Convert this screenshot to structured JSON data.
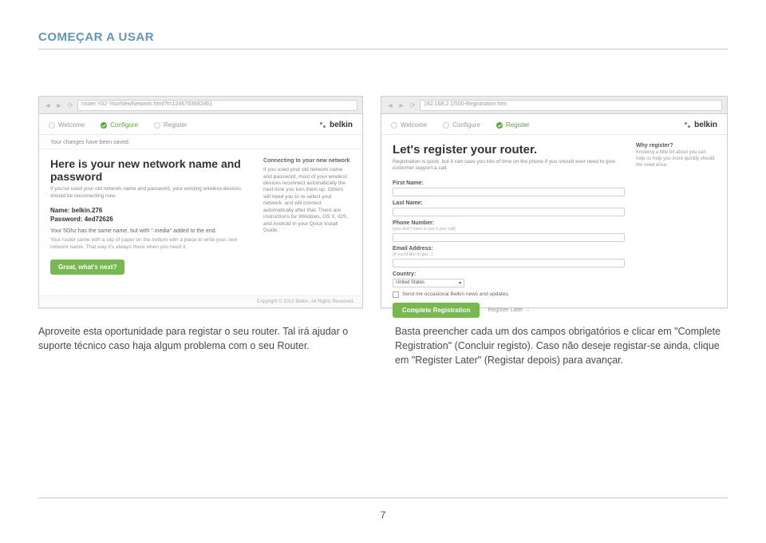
{
  "section_title": "COMEÇAR A USAR",
  "shot_left": {
    "url": "router.Y02-YourNewNetwork.html?t=1246793692461",
    "tabs": {
      "welcome": "Welcome",
      "configure": "Configure",
      "register": "Register"
    },
    "logo": "belkin",
    "saved": "Your changes have been saved.",
    "heading": "Here is your new network name and password",
    "desc": "If you've used your old network name and password, your existing wireless devices should be reconnecting now.",
    "name_label": "Name:",
    "name_value": "belkin.276",
    "pwd_label": "Password:",
    "pwd_value": "4ed72626",
    "note5g": "Your 5Ghz has the same name, but with \".media\" added to the end.",
    "slip": "Your router came with a slip of paper on the bottom with a place to write your new network name. That way it's always there when you need it.",
    "button": "Great, what's next?",
    "side_title": "Connecting to your new network",
    "side_text": "If you used your old network name and password, most of your wireless devices reconnect automatically the next time you turn them up. Others will need you to re-select your network, and will connect automatically after that. There are instructions for Windows, OS X, iOS, and Android in your Quick Install Guide.",
    "footer": "Copyright © 2012 Belkin. All Rights Reserved."
  },
  "shot_right": {
    "url": "192.168.2.1/500-Registration.htm",
    "tabs": {
      "welcome": "Welcome",
      "configure": "Configure",
      "register": "Register"
    },
    "logo": "belkin",
    "heading": "Let's register your router.",
    "desc": "Registration is quick, but it can save you lots of time on the phone if you should ever need to give customer support a call.",
    "first_name": "First Name:",
    "last_name": "Last Name:",
    "phone": "Phone Number:",
    "phone_hint": "(you don't have to put it you call)",
    "email": "Email Address:",
    "email_hint": "(if you'd like to get...)",
    "country": "Country:",
    "country_value": "United States",
    "news_cb": "Send me occasional Belkin news and updates.",
    "complete": "Complete Registration",
    "later": "Register Later →",
    "why_title": "Why register?",
    "why_text": "Knowing a little bit about you can help us help you more quickly should the need arise."
  },
  "body_left": "Aproveite esta oportunidade para registar o seu router. Tal irá ajudar o suporte técnico caso haja algum problema com o seu Router.",
  "body_right": "Basta preencher cada um dos campos obrigatórios e clicar em \"Complete Registration\" (Concluir registo). Caso não deseje registar-se ainda, clique em \"Register Later\" (Registar depois) para avançar.",
  "page_number": "7"
}
